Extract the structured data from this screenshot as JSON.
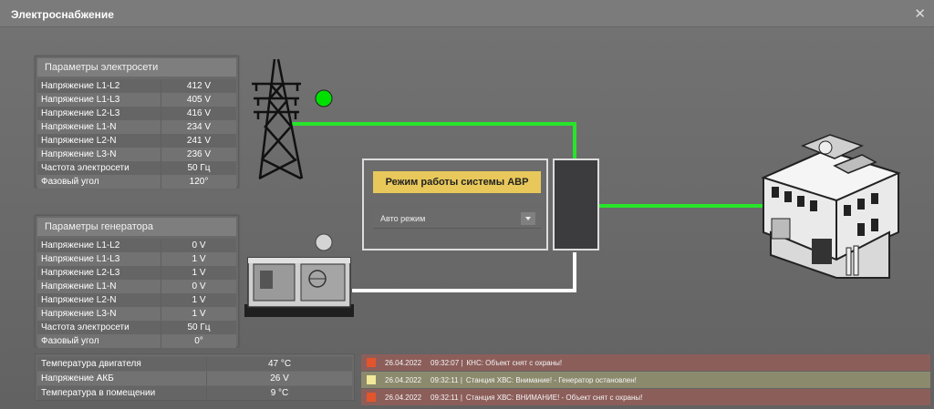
{
  "window": {
    "title": "Электроснабжение",
    "close_icon": "close-icon"
  },
  "grid_params": {
    "title": "Параметры электросети",
    "rows": [
      {
        "label": "Напряжение L1-L2",
        "value": "412 V"
      },
      {
        "label": "Напряжение L1-L3",
        "value": "405 V"
      },
      {
        "label": "Напряжение L2-L3",
        "value": "416 V"
      },
      {
        "label": "Напряжение L1-N",
        "value": "234 V"
      },
      {
        "label": "Напряжение L2-N",
        "value": "241 V"
      },
      {
        "label": "Напряжение L3-N",
        "value": "236 V"
      },
      {
        "label": "Частота электросети",
        "value": "50 Гц"
      },
      {
        "label": "Фазовый угол",
        "value": "120°"
      }
    ]
  },
  "generator_params": {
    "title": "Параметры генератора",
    "rows": [
      {
        "label": "Напряжение L1-L2",
        "value": "0 V"
      },
      {
        "label": "Напряжение L1-L3",
        "value": "1 V"
      },
      {
        "label": "Напряжение L2-L3",
        "value": "1 V"
      },
      {
        "label": "Напряжение L1-N",
        "value": "0 V"
      },
      {
        "label": "Напряжение L2-N",
        "value": "1 V"
      },
      {
        "label": "Напряжение L3-N",
        "value": "1 V"
      },
      {
        "label": "Частота электросети",
        "value": "50 Гц"
      },
      {
        "label": "Фазовый угол",
        "value": "0°"
      }
    ]
  },
  "engine_params": {
    "rows": [
      {
        "label": "Температура двигателя",
        "value": "47 °C"
      },
      {
        "label": "Напряжение АКБ",
        "value": "26 V"
      },
      {
        "label": "Температура в помещении",
        "value": "9 °C"
      }
    ]
  },
  "avr": {
    "button_label": "Режим работы системы АВР",
    "mode_value": "Авто режим"
  },
  "status": {
    "grid_indicator_color": "#00e000",
    "generator_indicator_color": "#d4d4d4",
    "active_line_color": "#27e52a",
    "inactive_line_color": "#ffffff"
  },
  "events": [
    {
      "level": "red",
      "color": "#e3542c",
      "date": "26.04.2022",
      "time": "09:32:07 |",
      "text": "КНС: Объект снят с охраны!"
    },
    {
      "level": "yellow",
      "color": "#f2e89a",
      "date": "26.04.2022",
      "time": "09:32:11 |",
      "text": "Станция ХВС: Внимание! - Генератор остановлен!"
    },
    {
      "level": "red",
      "color": "#e3542c",
      "date": "26.04.2022",
      "time": "09:32:11 |",
      "text": "Станция ХВС: ВНИМАНИЕ! - Объект снят с охраны!"
    }
  ]
}
